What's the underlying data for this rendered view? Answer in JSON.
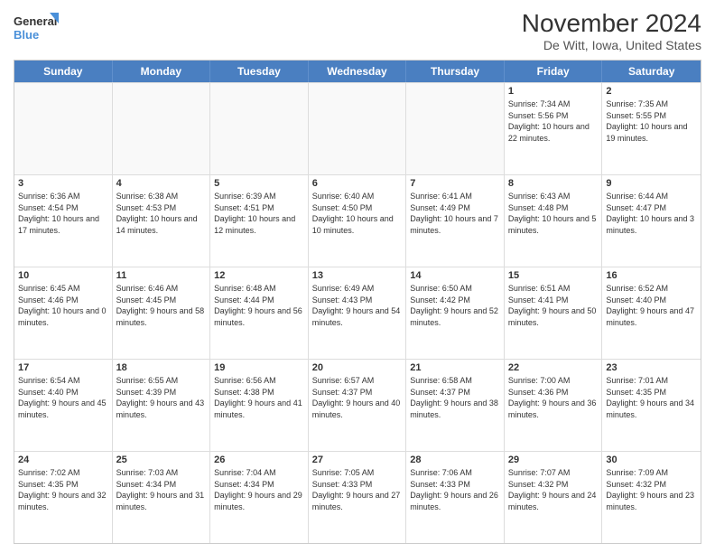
{
  "logo": {
    "line1": "General",
    "line2": "Blue"
  },
  "title": "November 2024",
  "subtitle": "De Witt, Iowa, United States",
  "header_days": [
    "Sunday",
    "Monday",
    "Tuesday",
    "Wednesday",
    "Thursday",
    "Friday",
    "Saturday"
  ],
  "weeks": [
    [
      {
        "day": "",
        "info": ""
      },
      {
        "day": "",
        "info": ""
      },
      {
        "day": "",
        "info": ""
      },
      {
        "day": "",
        "info": ""
      },
      {
        "day": "",
        "info": ""
      },
      {
        "day": "1",
        "info": "Sunrise: 7:34 AM\nSunset: 5:56 PM\nDaylight: 10 hours and 22 minutes."
      },
      {
        "day": "2",
        "info": "Sunrise: 7:35 AM\nSunset: 5:55 PM\nDaylight: 10 hours and 19 minutes."
      }
    ],
    [
      {
        "day": "3",
        "info": "Sunrise: 6:36 AM\nSunset: 4:54 PM\nDaylight: 10 hours and 17 minutes."
      },
      {
        "day": "4",
        "info": "Sunrise: 6:38 AM\nSunset: 4:53 PM\nDaylight: 10 hours and 14 minutes."
      },
      {
        "day": "5",
        "info": "Sunrise: 6:39 AM\nSunset: 4:51 PM\nDaylight: 10 hours and 12 minutes."
      },
      {
        "day": "6",
        "info": "Sunrise: 6:40 AM\nSunset: 4:50 PM\nDaylight: 10 hours and 10 minutes."
      },
      {
        "day": "7",
        "info": "Sunrise: 6:41 AM\nSunset: 4:49 PM\nDaylight: 10 hours and 7 minutes."
      },
      {
        "day": "8",
        "info": "Sunrise: 6:43 AM\nSunset: 4:48 PM\nDaylight: 10 hours and 5 minutes."
      },
      {
        "day": "9",
        "info": "Sunrise: 6:44 AM\nSunset: 4:47 PM\nDaylight: 10 hours and 3 minutes."
      }
    ],
    [
      {
        "day": "10",
        "info": "Sunrise: 6:45 AM\nSunset: 4:46 PM\nDaylight: 10 hours and 0 minutes."
      },
      {
        "day": "11",
        "info": "Sunrise: 6:46 AM\nSunset: 4:45 PM\nDaylight: 9 hours and 58 minutes."
      },
      {
        "day": "12",
        "info": "Sunrise: 6:48 AM\nSunset: 4:44 PM\nDaylight: 9 hours and 56 minutes."
      },
      {
        "day": "13",
        "info": "Sunrise: 6:49 AM\nSunset: 4:43 PM\nDaylight: 9 hours and 54 minutes."
      },
      {
        "day": "14",
        "info": "Sunrise: 6:50 AM\nSunset: 4:42 PM\nDaylight: 9 hours and 52 minutes."
      },
      {
        "day": "15",
        "info": "Sunrise: 6:51 AM\nSunset: 4:41 PM\nDaylight: 9 hours and 50 minutes."
      },
      {
        "day": "16",
        "info": "Sunrise: 6:52 AM\nSunset: 4:40 PM\nDaylight: 9 hours and 47 minutes."
      }
    ],
    [
      {
        "day": "17",
        "info": "Sunrise: 6:54 AM\nSunset: 4:40 PM\nDaylight: 9 hours and 45 minutes."
      },
      {
        "day": "18",
        "info": "Sunrise: 6:55 AM\nSunset: 4:39 PM\nDaylight: 9 hours and 43 minutes."
      },
      {
        "day": "19",
        "info": "Sunrise: 6:56 AM\nSunset: 4:38 PM\nDaylight: 9 hours and 41 minutes."
      },
      {
        "day": "20",
        "info": "Sunrise: 6:57 AM\nSunset: 4:37 PM\nDaylight: 9 hours and 40 minutes."
      },
      {
        "day": "21",
        "info": "Sunrise: 6:58 AM\nSunset: 4:37 PM\nDaylight: 9 hours and 38 minutes."
      },
      {
        "day": "22",
        "info": "Sunrise: 7:00 AM\nSunset: 4:36 PM\nDaylight: 9 hours and 36 minutes."
      },
      {
        "day": "23",
        "info": "Sunrise: 7:01 AM\nSunset: 4:35 PM\nDaylight: 9 hours and 34 minutes."
      }
    ],
    [
      {
        "day": "24",
        "info": "Sunrise: 7:02 AM\nSunset: 4:35 PM\nDaylight: 9 hours and 32 minutes."
      },
      {
        "day": "25",
        "info": "Sunrise: 7:03 AM\nSunset: 4:34 PM\nDaylight: 9 hours and 31 minutes."
      },
      {
        "day": "26",
        "info": "Sunrise: 7:04 AM\nSunset: 4:34 PM\nDaylight: 9 hours and 29 minutes."
      },
      {
        "day": "27",
        "info": "Sunrise: 7:05 AM\nSunset: 4:33 PM\nDaylight: 9 hours and 27 minutes."
      },
      {
        "day": "28",
        "info": "Sunrise: 7:06 AM\nSunset: 4:33 PM\nDaylight: 9 hours and 26 minutes."
      },
      {
        "day": "29",
        "info": "Sunrise: 7:07 AM\nSunset: 4:32 PM\nDaylight: 9 hours and 24 minutes."
      },
      {
        "day": "30",
        "info": "Sunrise: 7:09 AM\nSunset: 4:32 PM\nDaylight: 9 hours and 23 minutes."
      }
    ]
  ]
}
